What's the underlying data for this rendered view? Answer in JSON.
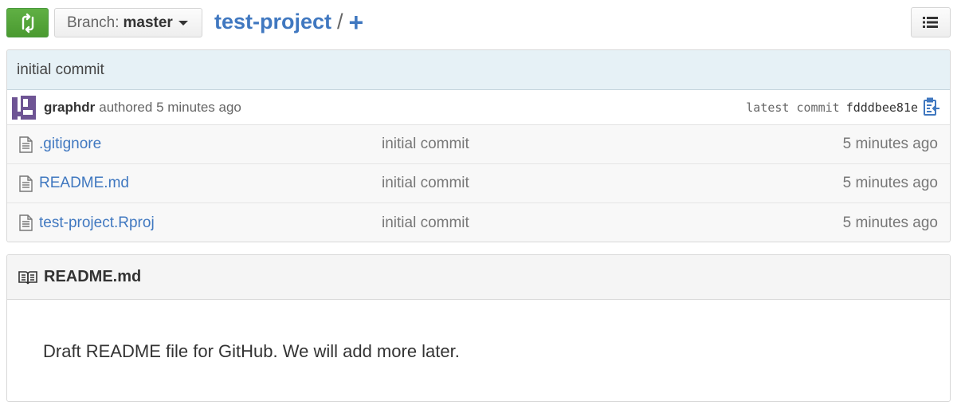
{
  "toolbar": {
    "branch_prefix": "Branch:",
    "branch_name": "master",
    "repo_name": "test-project",
    "separator": "/",
    "new_file": "+"
  },
  "commit": {
    "message": "initial commit",
    "author": "graphdr",
    "authored_text": "authored 5 minutes ago",
    "latest_label": "latest commit",
    "sha": "fdddbee81e"
  },
  "files": [
    {
      "name": ".gitignore",
      "message": "initial commit",
      "age": "5 minutes ago"
    },
    {
      "name": "README.md",
      "message": "initial commit",
      "age": "5 minutes ago"
    },
    {
      "name": "test-project.Rproj",
      "message": "initial commit",
      "age": "5 minutes ago"
    }
  ],
  "readme": {
    "title": "README.md",
    "content": "Draft README file for GitHub. We will add more later."
  },
  "colors": {
    "link": "#4078c0",
    "compare_button": "#60b044",
    "commit_bar": "#e6f1f6",
    "avatar": "#6e5494"
  },
  "icons": {
    "compare": "compare-arrows-icon",
    "list": "list-icon",
    "file": "file-text-icon",
    "clipboard": "clippy-icon",
    "book": "book-icon"
  }
}
